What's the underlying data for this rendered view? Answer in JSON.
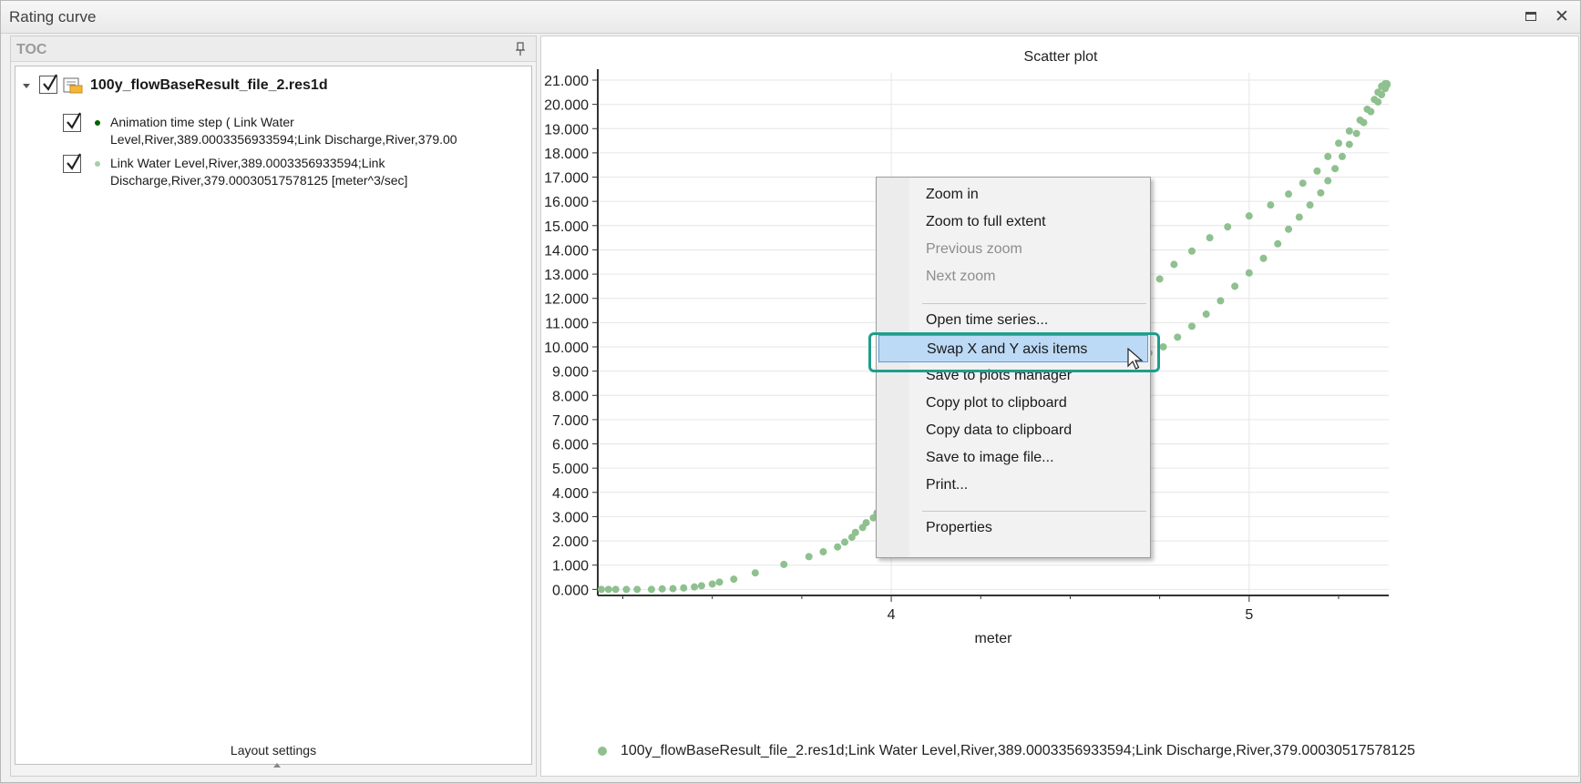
{
  "window": {
    "title": "Rating curve"
  },
  "toc": {
    "title": "TOC",
    "root": {
      "label": "100y_flowBaseResult_file_2.res1d",
      "checked": true
    },
    "items": [
      {
        "label": "Animation time step ( Link Water\nLevel,River,389.0003356933594;Link Discharge,River,379.00",
        "checked": true,
        "dot_color": "#006400"
      },
      {
        "label": "Link Water Level,River,389.0003356933594;Link\nDischarge,River,379.00030517578125 [meter^3/sec]",
        "checked": true,
        "dot_color": "#8fc08f"
      }
    ],
    "layout_settings": "Layout settings"
  },
  "chart_data": {
    "type": "scatter",
    "title": "Scatter plot",
    "xlabel": "meter",
    "ylabel": "[meter^3/sec]",
    "xlim": [
      3.18,
      5.39
    ],
    "ylim": [
      -0.25,
      21.3
    ],
    "x_ticks": [
      {
        "value": 4,
        "label": "4"
      },
      {
        "value": 5,
        "label": "5"
      }
    ],
    "x_minor_ticks": [
      3.25,
      3.5,
      3.75,
      4.25,
      4.5,
      4.75,
      5.25
    ],
    "y_ticks": [
      0,
      1,
      2,
      3,
      4,
      5,
      6,
      7,
      8,
      9,
      10,
      11,
      12,
      13,
      14,
      15,
      16,
      17,
      18,
      19,
      20,
      21
    ],
    "y_tick_labels": [
      "0.000",
      "1.000",
      "2.000",
      "3.000",
      "4.000",
      "5.000",
      "6.000",
      "7.000",
      "8.000",
      "9.000",
      "10.000",
      "11.000",
      "12.000",
      "13.000",
      "14.000",
      "15.000",
      "16.000",
      "17.000",
      "18.000",
      "19.000",
      "20.000",
      "21.000"
    ],
    "grid": true,
    "legend": "bottom",
    "series": [
      {
        "name": "100y_flowBaseResult_file_2.res1d;Link Water Level,River,389.0003356933594;Link Discharge,River,379.00030517578125",
        "color": "#8fc08f",
        "x": [
          3.19,
          3.21,
          3.23,
          3.26,
          3.29,
          3.33,
          3.36,
          3.39,
          3.42,
          3.45,
          3.47,
          3.5,
          3.52,
          3.56,
          3.62,
          3.7,
          3.77,
          3.81,
          3.85,
          3.87,
          3.89,
          3.9,
          3.92,
          3.93,
          3.95,
          3.96,
          3.98,
          3.99,
          4.0,
          4.42,
          4.43,
          4.44,
          4.45,
          4.46,
          4.48,
          4.5,
          4.52,
          4.54,
          4.56,
          4.58,
          4.61,
          4.64,
          4.67,
          4.71,
          4.75,
          4.79,
          4.84,
          4.89,
          4.94,
          5.0,
          5.06,
          5.11,
          5.15,
          5.19,
          5.22,
          5.25,
          5.28,
          5.31,
          5.33,
          5.35,
          5.36,
          5.37,
          5.38,
          5.385,
          5.385,
          5.38,
          5.37,
          5.36,
          5.34,
          5.32,
          5.3,
          5.28,
          5.26,
          5.24,
          5.22,
          5.2,
          5.17,
          5.14,
          5.11,
          5.08,
          5.04,
          5.0,
          4.96,
          4.92,
          4.88,
          4.84,
          4.8,
          4.76,
          4.72,
          4.69,
          4.66,
          4.63,
          4.61,
          4.59,
          4.57,
          4.55,
          4.54,
          4.52,
          4.51,
          4.5,
          4.49,
          4.47,
          4.46,
          4.45,
          4.43
        ],
        "y": [
          0.0,
          0.0,
          0.0,
          0.0,
          0.0,
          0.0,
          0.02,
          0.03,
          0.06,
          0.1,
          0.15,
          0.22,
          0.3,
          0.42,
          0.68,
          1.03,
          1.35,
          1.55,
          1.75,
          1.95,
          2.15,
          2.35,
          2.55,
          2.75,
          2.95,
          3.15,
          3.3,
          3.42,
          3.55,
          7.95,
          8.2,
          8.35,
          8.5,
          8.65,
          8.85,
          9.05,
          9.3,
          9.55,
          9.85,
          10.2,
          10.6,
          11.0,
          11.6,
          12.15,
          12.8,
          13.4,
          13.95,
          14.5,
          14.95,
          15.4,
          15.85,
          16.3,
          16.75,
          17.25,
          17.85,
          18.4,
          18.9,
          19.35,
          19.8,
          20.2,
          20.5,
          20.75,
          20.85,
          20.85,
          20.8,
          20.65,
          20.4,
          20.1,
          19.7,
          19.25,
          18.8,
          18.35,
          17.85,
          17.35,
          16.85,
          16.35,
          15.85,
          15.35,
          14.85,
          14.25,
          13.65,
          13.05,
          12.5,
          11.9,
          11.35,
          10.85,
          10.4,
          10.0,
          9.75,
          9.5,
          9.3,
          9.1,
          8.9,
          8.7,
          8.55,
          8.4,
          8.25,
          8.1,
          8.0,
          7.9,
          7.8,
          7.7,
          7.6,
          7.5,
          7.4
        ]
      },
      {
        "name": "Animation time step",
        "color": "#006400",
        "x": [
          4.47
        ],
        "y": [
          9.7
        ]
      }
    ]
  },
  "context_menu": {
    "items": [
      {
        "label": "Zoom in",
        "enabled": true
      },
      {
        "label": "Zoom to full extent",
        "enabled": true
      },
      {
        "label": "Previous zoom",
        "enabled": false
      },
      {
        "label": "Next zoom",
        "enabled": false
      },
      {
        "label": "Open time series...",
        "enabled": true
      },
      {
        "label": "Swap X and Y axis items",
        "enabled": true,
        "highlighted": true
      },
      {
        "label": "Save to plots manager",
        "enabled": true
      },
      {
        "label": "Copy plot to clipboard",
        "enabled": true
      },
      {
        "label": "Copy data to clipboard",
        "enabled": true
      },
      {
        "label": "Save to image file...",
        "enabled": true
      },
      {
        "label": "Print...",
        "enabled": true
      },
      {
        "label": "Properties",
        "enabled": true
      }
    ]
  },
  "colors": {
    "accent_highlight": "#1f9e8c",
    "menu_selection": "#bcd9f5"
  }
}
